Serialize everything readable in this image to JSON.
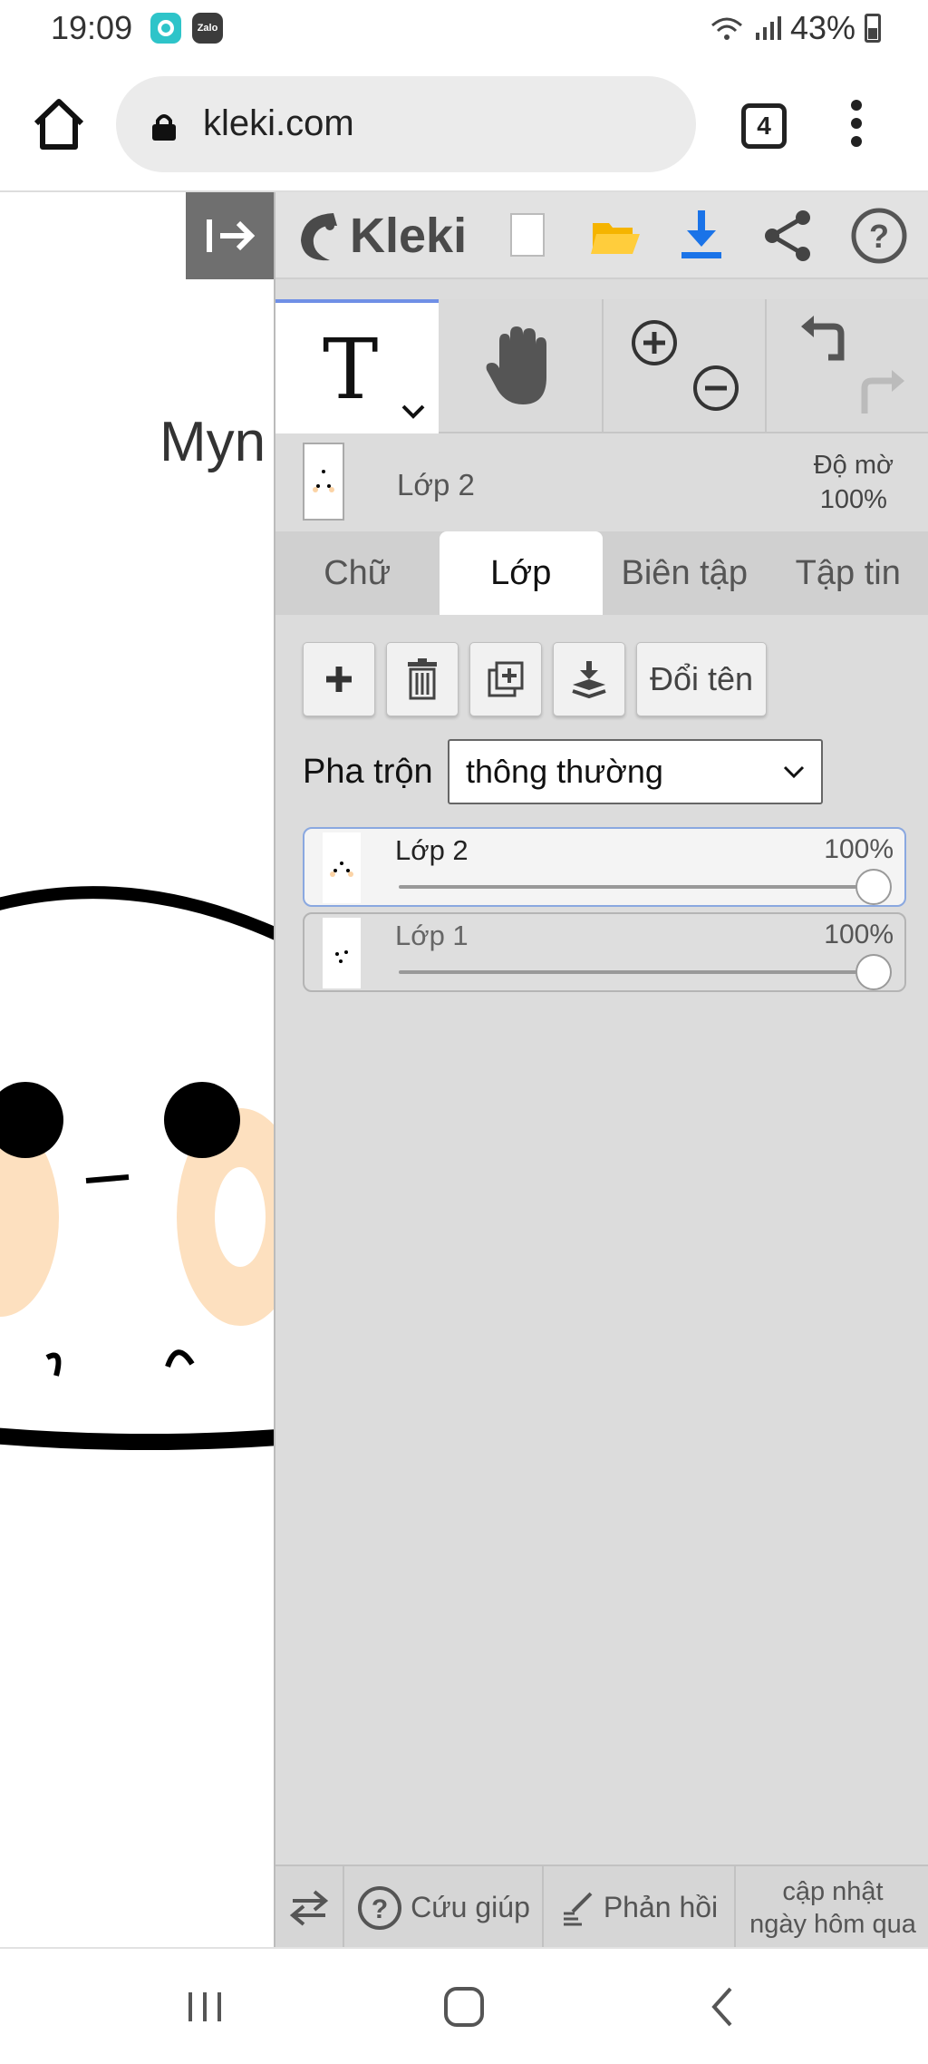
{
  "status": {
    "time": "19:09",
    "zalo_label": "Zalo",
    "battery": "43%"
  },
  "browser": {
    "url": "kleki.com",
    "tab_count": "4"
  },
  "canvas": {
    "text_fragment": "Myn"
  },
  "app": {
    "name": "Kleki"
  },
  "layer_info": {
    "name": "Lớp 2",
    "opacity_label": "Độ mờ",
    "opacity_value": "100%"
  },
  "tabs": [
    "Chữ",
    "Lớp",
    "Biên tập",
    "Tập tin"
  ],
  "actions": {
    "rename": "Đổi tên"
  },
  "blend": {
    "label": "Pha trộn",
    "value": "thông thường"
  },
  "layers": [
    {
      "name": "Lớp 2",
      "opacity": "100%",
      "level": 1.0
    },
    {
      "name": "Lớp 1",
      "opacity": "100%",
      "level": 1.0
    }
  ],
  "footer": {
    "help": "Cứu giúp",
    "feedback": "Phản hồi",
    "update_line1": "cập nhật",
    "update_line2": "ngày hôm qua"
  },
  "colors": {
    "accent": "#6f8fe6",
    "panel": "#dcdcdc",
    "download": "#1a73e8",
    "folder": "#f5b400"
  }
}
